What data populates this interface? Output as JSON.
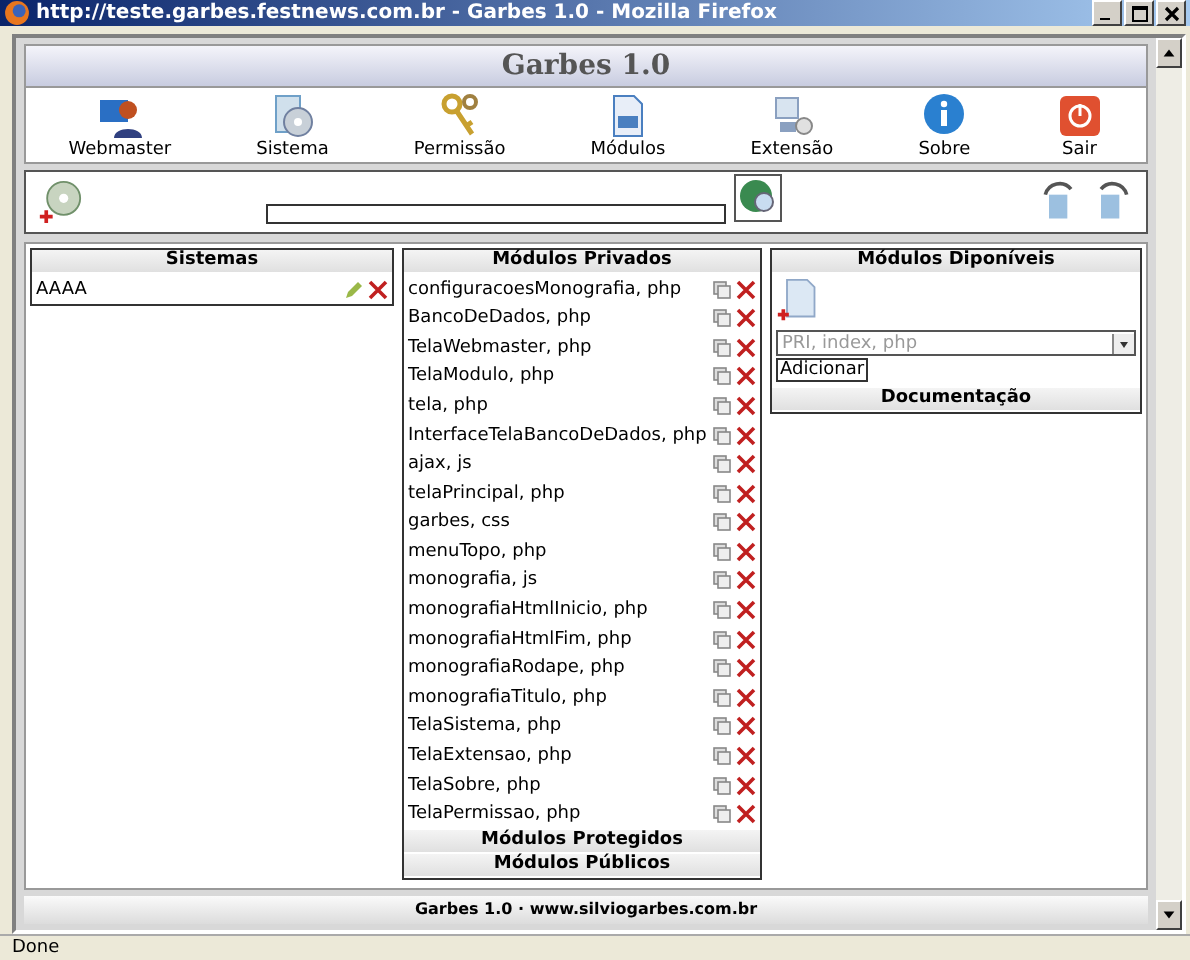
{
  "window": {
    "title": "http://teste.garbes.festnews.com.br - Garbes 1.0 - Mozilla Firefox"
  },
  "header": {
    "title": "Garbes 1.0"
  },
  "menu": [
    {
      "label": "Webmaster",
      "kind": "webmaster"
    },
    {
      "label": "Sistema",
      "kind": "sistema"
    },
    {
      "label": "Permissão",
      "kind": "permissao"
    },
    {
      "label": "Módulos",
      "kind": "modulos"
    },
    {
      "label": "Extensão",
      "kind": "extensao"
    },
    {
      "label": "Sobre",
      "kind": "sobre"
    },
    {
      "label": "Sair",
      "kind": "sair"
    }
  ],
  "sistemas": {
    "title": "Sistemas",
    "items": [
      "AAAA"
    ]
  },
  "modulos_privados": {
    "title": "Módulos Privados",
    "items": [
      "configuracoesMonografia, php",
      "BancoDeDados, php",
      "TelaWebmaster, php",
      "TelaModulo, php",
      "tela, php",
      "InterfaceTelaBancoDeDados, php",
      "ajax, js",
      "telaPrincipal, php",
      "garbes, css",
      "menuTopo, php",
      "monografia, js",
      "monografiaHtmlInicio, php",
      "monografiaHtmlFim, php",
      "monografiaRodape, php",
      "monografiaTitulo, php",
      "TelaSistema, php",
      "TelaExtensao, php",
      "TelaSobre, php",
      "TelaPermissao, php"
    ],
    "sections": [
      "Módulos Protegidos",
      "Módulos Públicos"
    ]
  },
  "modulos_disponiveis": {
    "title": "Módulos Diponíveis",
    "select": {
      "value": "PRI, index, php",
      "disabled": true
    },
    "button": "Adicionar",
    "section": "Documentação"
  },
  "footer": "Garbes 1.0 · www.silviogarbes.com.br",
  "status_bar": "Done"
}
